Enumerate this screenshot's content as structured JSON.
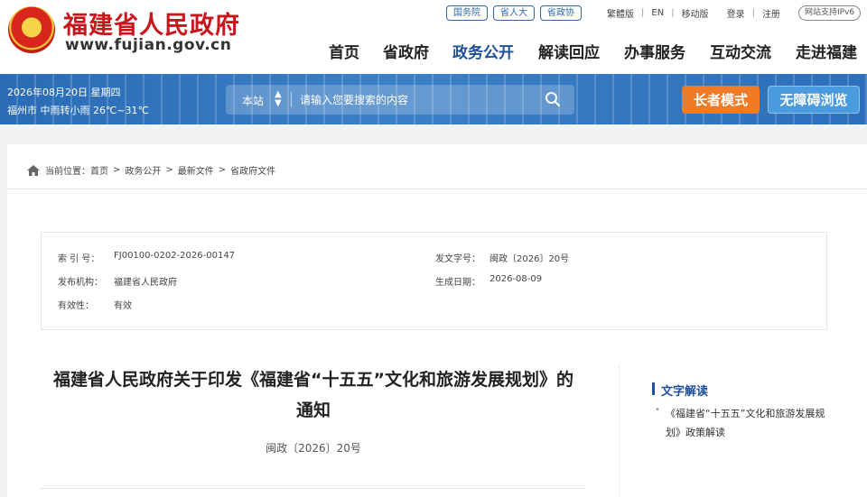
{
  "header": {
    "site_title": "福建省人民政府",
    "site_url": "www.fujian.gov.cn",
    "top_links": [
      "国务院",
      "省人大",
      "省政协"
    ],
    "util_links": [
      "繁體版",
      "EN",
      "移动版"
    ],
    "account_links": [
      "登录",
      "注册"
    ],
    "ipv6": "网站支持IPv6",
    "nav": [
      "首页",
      "省政府",
      "政务公开",
      "解读回应",
      "办事服务",
      "互动交流",
      "走进福建"
    ],
    "nav_active": "政务公开"
  },
  "banner": {
    "date": "2026年08月20日 星期四",
    "weather": "福州市 中雨转小雨 26℃~31℃",
    "search_scope": "本站",
    "search_placeholder": "请输入您要搜索的内容",
    "elder_mode": "长者模式",
    "accessible": "无障碍浏览"
  },
  "breadcrumb": {
    "prefix": "当前位置：",
    "items": [
      "首页",
      "政务公开",
      "最新文件",
      "省政府文件"
    ],
    "separator": ">"
  },
  "meta": {
    "index_label": "索 引 号：",
    "index_value": "FJ00100-0202-2026-00147",
    "docno_label": "发文字号：",
    "docno_value": "闽政〔2026〕20号",
    "issuer_label": "发布机构：",
    "issuer_value": "福建省人民政府",
    "date_label": "生成日期：",
    "date_value": "2026-08-09",
    "validity_label": "有效性：",
    "validity_value": "有效"
  },
  "document": {
    "title": "福建省人民政府关于印发《福建省“十五五”文化和旅游发展规划》的通知",
    "number": "闽政〔2026〕20号"
  },
  "sidebar": {
    "heading": "文字解读",
    "links": [
      "《福建省“十五五”文化和旅游发展规划》政策解读"
    ]
  },
  "colors": {
    "brand_red": "#c8161d",
    "brand_blue": "#1d4e9a",
    "banner_blue": "#3b7fc6",
    "elder_orange": "#f07b26"
  }
}
